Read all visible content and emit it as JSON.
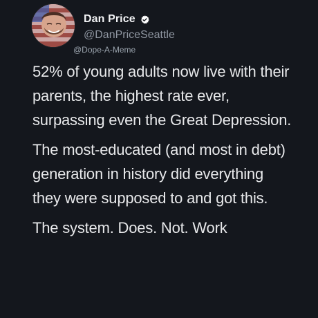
{
  "tweet": {
    "author": {
      "name": "Dan Price",
      "handle": "@DanPriceSeattle",
      "verified_icon": "verified-badge-icon",
      "avatar_icon": "avatar"
    },
    "watermark": "@Dope-A-Meme",
    "paragraphs": [
      "52% of young adults now live with their parents, the highest rate ever, surpassing even the Great Depression.",
      "The most-educated (and most in debt) generation in history did everything they were supposed to and got this.",
      "The system. Does. Not. Work"
    ]
  },
  "colors": {
    "background": "#14171d",
    "text": "#e7e8ea",
    "muted": "#8f96a1",
    "verified": "#ffffff"
  }
}
